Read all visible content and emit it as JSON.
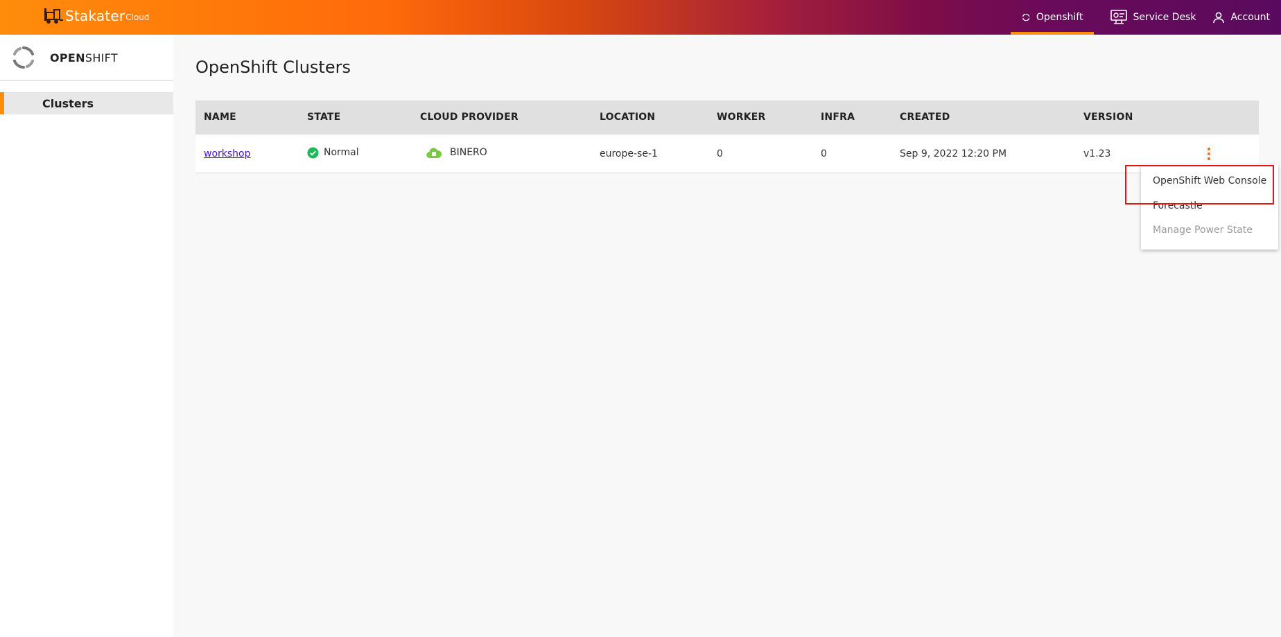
{
  "brand": {
    "name": "Stakater",
    "suffix": "Cloud"
  },
  "topnav": {
    "items": [
      {
        "label": "Openshift",
        "icon": "openshift-icon",
        "active": true
      },
      {
        "label": "Service Desk",
        "icon": "service-desk-icon",
        "active": false
      },
      {
        "label": "Account",
        "icon": "account-icon",
        "active": false
      }
    ]
  },
  "sidebar": {
    "title_bold": "OPEN",
    "title_rest": "SHIFT",
    "items": [
      {
        "label": "Clusters",
        "active": true
      }
    ]
  },
  "main": {
    "title": "OpenShift Clusters",
    "table": {
      "columns": [
        "NAME",
        "STATE",
        "CLOUD PROVIDER",
        "LOCATION",
        "WORKER",
        "INFRA",
        "CREATED",
        "VERSION"
      ],
      "rows": [
        {
          "name": "workshop",
          "state": "Normal",
          "cloud_provider": "BINERO",
          "location": "europe-se-1",
          "worker": "0",
          "infra": "0",
          "created": "Sep 9, 2022 12:20 PM",
          "version": "v1.23"
        }
      ]
    }
  },
  "row_menu": {
    "items": [
      {
        "label": "OpenShift Web Console",
        "disabled": false
      },
      {
        "label": "Forecastle",
        "disabled": false
      },
      {
        "label": "Manage Power State",
        "disabled": true
      }
    ]
  },
  "colors": {
    "accent": "#ff8c0b",
    "link": "#4d0fd1",
    "success": "#1eb85a",
    "provider": "#7ac943",
    "highlight": "#e11111"
  }
}
